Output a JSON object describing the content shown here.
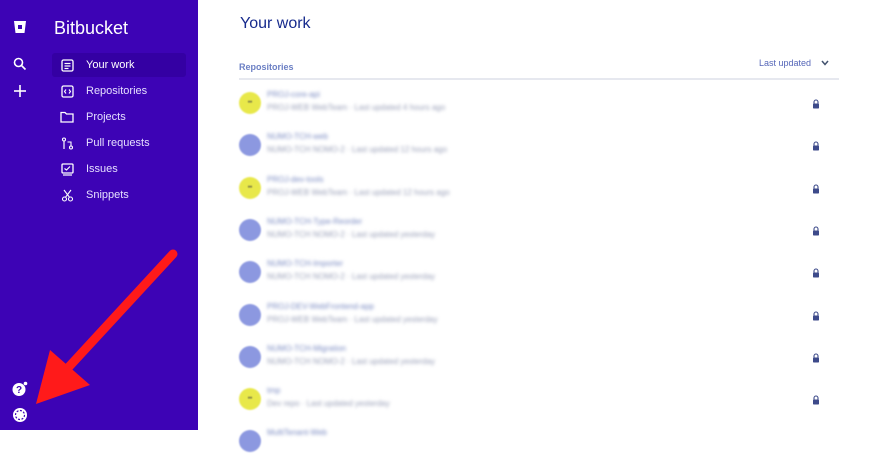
{
  "app": {
    "name": "Bitbucket"
  },
  "nav": {
    "items": [
      {
        "label": "Your work",
        "icon": "your-work-icon",
        "active": true
      },
      {
        "label": "Repositories",
        "icon": "repositories-icon",
        "active": false
      },
      {
        "label": "Projects",
        "icon": "projects-icon",
        "active": false
      },
      {
        "label": "Pull requests",
        "icon": "pull-requests-icon",
        "active": false
      },
      {
        "label": "Issues",
        "icon": "issues-icon",
        "active": false
      },
      {
        "label": "Snippets",
        "icon": "snippets-icon",
        "active": false
      }
    ]
  },
  "rail": {
    "icons": [
      "bitbucket-logo-icon",
      "search-icon",
      "plus-icon",
      "help-icon",
      "user-avatar-icon"
    ]
  },
  "main": {
    "title": "Your work",
    "repositories": {
      "label": "Repositories",
      "sort_label": "Last updated",
      "items": [
        {
          "name": "PROJ-core-api",
          "meta": "PROJ-WEB WebTeam · Last updated 4 hours ago",
          "avatar_color": "#e8e84a"
        },
        {
          "name": "NUMO-TCH-web",
          "meta": "NUMO-TCH NOMO-2 · Last updated 12 hours ago",
          "avatar_color": "#8c98e0"
        },
        {
          "name": "PROJ-dev-tools",
          "meta": "PROJ-WEB WebTeam · Last updated 12 hours ago",
          "avatar_color": "#e8e84a"
        },
        {
          "name": "NUMO-TCH-Type-Reorder",
          "meta": "NUMO-TCH NOMO-2 · Last updated yesterday",
          "avatar_color": "#8c98e0"
        },
        {
          "name": "NUMO-TCH-Importer",
          "meta": "NUMO-TCH NOMO-2 · Last updated yesterday",
          "avatar_color": "#8c98e0"
        },
        {
          "name": "PROJ-DEV-WebFrontend-app",
          "meta": "PROJ-WEB WebTeam · Last updated yesterday",
          "avatar_color": "#8c98e0"
        },
        {
          "name": "NUMO-TCH-Migration",
          "meta": "NUMO-TCH NOMO-2 · Last updated yesterday",
          "avatar_color": "#8c98e0"
        },
        {
          "name": "tmp",
          "meta": "Dev repo · Last updated yesterday",
          "avatar_color": "#e8e84a"
        },
        {
          "name": "MultiTenant-Web",
          "meta": "",
          "avatar_color": "#8c98e0"
        }
      ]
    }
  },
  "colors": {
    "sidebar": "#3d03b5",
    "active_item": "#3400a3",
    "title": "#172b8d",
    "annotation_arrow": "#ff1a1a"
  }
}
